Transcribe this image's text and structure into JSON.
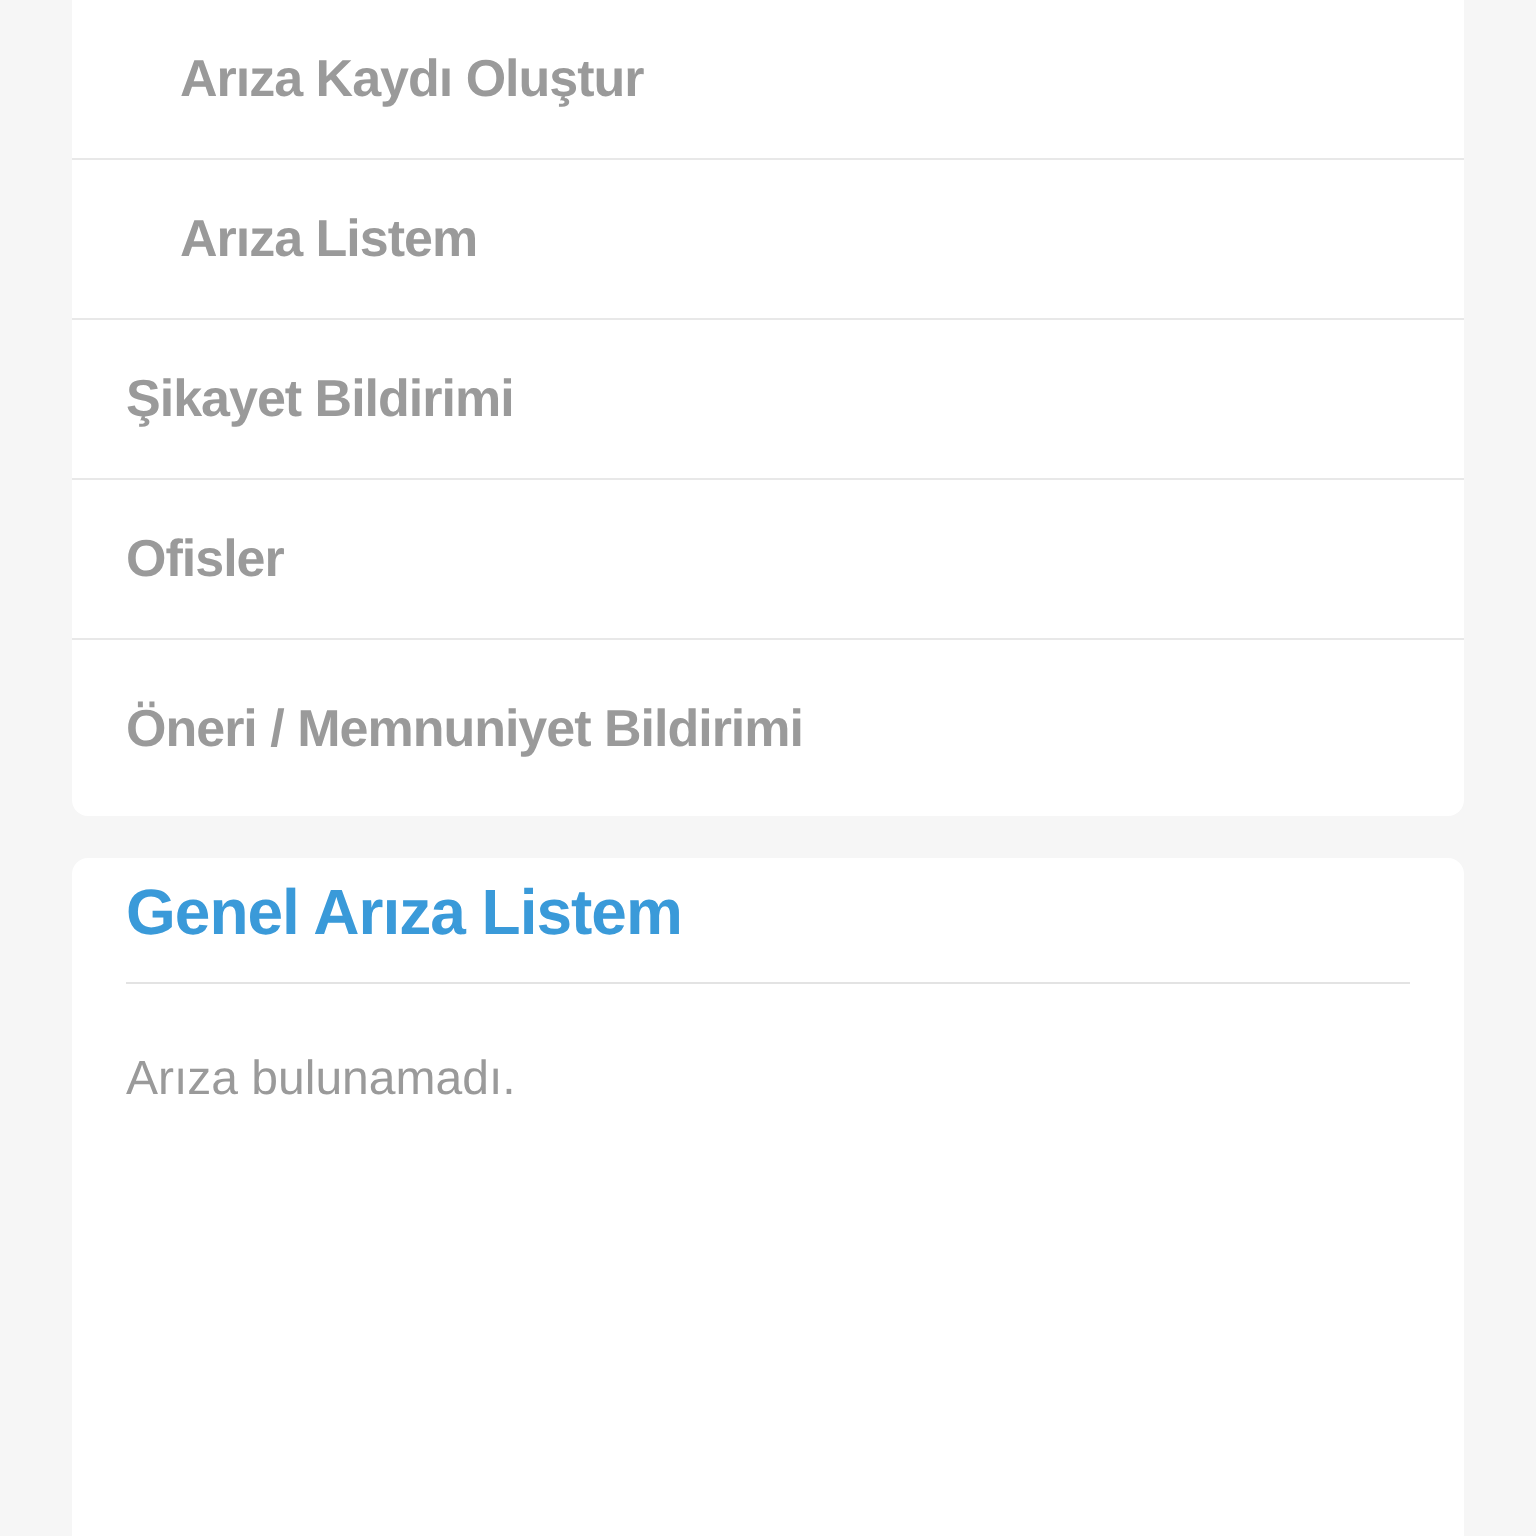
{
  "menu": [
    {
      "label": "Arıza Kaydı Oluştur",
      "kind": "sub"
    },
    {
      "label": "Arıza Listem",
      "kind": "sub"
    },
    {
      "label": "Şikayet Bildirimi",
      "kind": "top"
    },
    {
      "label": "Ofisler",
      "kind": "top"
    },
    {
      "label": "Öneri / Memnuniyet Bildirimi",
      "kind": "top"
    }
  ],
  "panel": {
    "title": "Genel Arıza Listem",
    "empty_text": "Arıza bulunamadı."
  }
}
